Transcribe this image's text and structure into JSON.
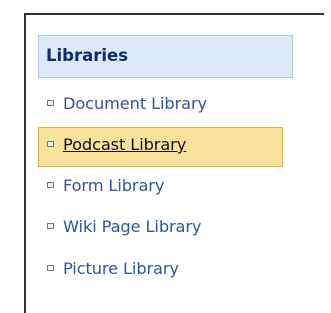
{
  "libraries": {
    "title": "Libraries",
    "items": [
      {
        "label": "Document Library"
      },
      {
        "label": "Podcast Library",
        "selected": true
      },
      {
        "label": "Form Library"
      },
      {
        "label": "Wiki Page Library"
      },
      {
        "label": "Picture Library"
      }
    ]
  },
  "colors": {
    "header_bg": "#dde8f8",
    "header_text": "#0b2d6b",
    "link_text": "#2a5aa0",
    "selected_bg": "#fbe29a",
    "selected_border": "#e2ad4b"
  },
  "icons": {
    "bullet": "small-square-bullet-icon"
  }
}
